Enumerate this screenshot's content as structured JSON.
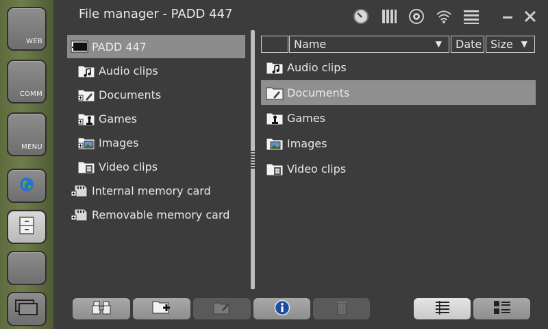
{
  "window": {
    "title": "File manager - PADD 447"
  },
  "launcher": {
    "items": [
      {
        "label": "WEB",
        "icon": "web-icon"
      },
      {
        "label": "COMM",
        "icon": "comm-icon"
      },
      {
        "label": "MENU",
        "icon": "menu-icon"
      },
      {
        "label": "",
        "icon": "globe-icon"
      },
      {
        "label": "",
        "icon": "file-cabinet-icon"
      },
      {
        "label": "",
        "icon": "blank-icon"
      },
      {
        "label": "",
        "icon": "windows-icon"
      }
    ]
  },
  "status_icons": [
    "clock-icon",
    "battery-icon",
    "radio-icon",
    "wifi-icon",
    "menu-lines-icon",
    "minimize-icon",
    "close-icon"
  ],
  "tree": {
    "root": "PADD 447",
    "folders": [
      "Audio clips",
      "Documents",
      "Games",
      "Images",
      "Video clips"
    ],
    "cards": [
      "Internal memory card",
      "Removable memory card"
    ]
  },
  "list": {
    "columns": {
      "name": "Name",
      "date": "Date",
      "size": "Size"
    },
    "items": [
      "Audio clips",
      "Documents",
      "Games",
      "Images",
      "Video clips"
    ],
    "selected": "Documents"
  },
  "toolbar": {
    "buttons": [
      "find-icon",
      "new-folder-icon",
      "rename-icon",
      "info-icon",
      "delete-icon"
    ],
    "views": [
      "list-view-icon",
      "detail-view-icon"
    ]
  }
}
